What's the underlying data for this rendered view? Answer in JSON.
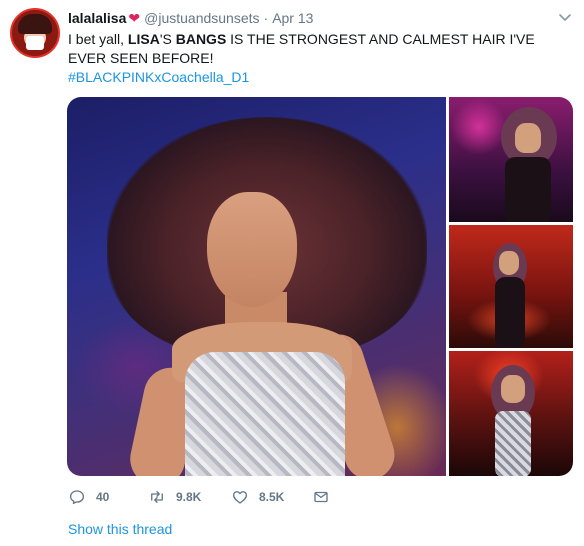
{
  "tweet": {
    "user": {
      "display_name": "lalalalisa",
      "handle": "@justuandsunsets",
      "separator": "·",
      "date": "Apr 13",
      "name_emoji": "heart-emoji"
    },
    "text": {
      "part1": "I bet yall, ",
      "bold1": "LISA",
      "part2": "'S ",
      "bold2": "BANGS",
      "part3": " IS THE STRONGEST AND CALMEST HAIR I'VE EVER SEEN BEFORE!"
    },
    "hashtag": "#BLACKPINKxCoachella_D1",
    "media": {
      "photos": [
        "main-photo",
        "thumbnail-1",
        "thumbnail-2",
        "thumbnail-3"
      ]
    },
    "actions": {
      "reply_count": "40",
      "retweet_count": "9.8K",
      "like_count": "8.5K"
    },
    "show_thread": "Show this thread"
  },
  "colors": {
    "text": "#14171a",
    "secondary": "#657786",
    "link": "#1b95e0",
    "heart": "#e0245e"
  },
  "icons": {
    "reply": "reply-icon",
    "retweet": "retweet-icon",
    "like": "like-icon",
    "dm": "direct-message-icon",
    "caret": "chevron-down-icon"
  }
}
